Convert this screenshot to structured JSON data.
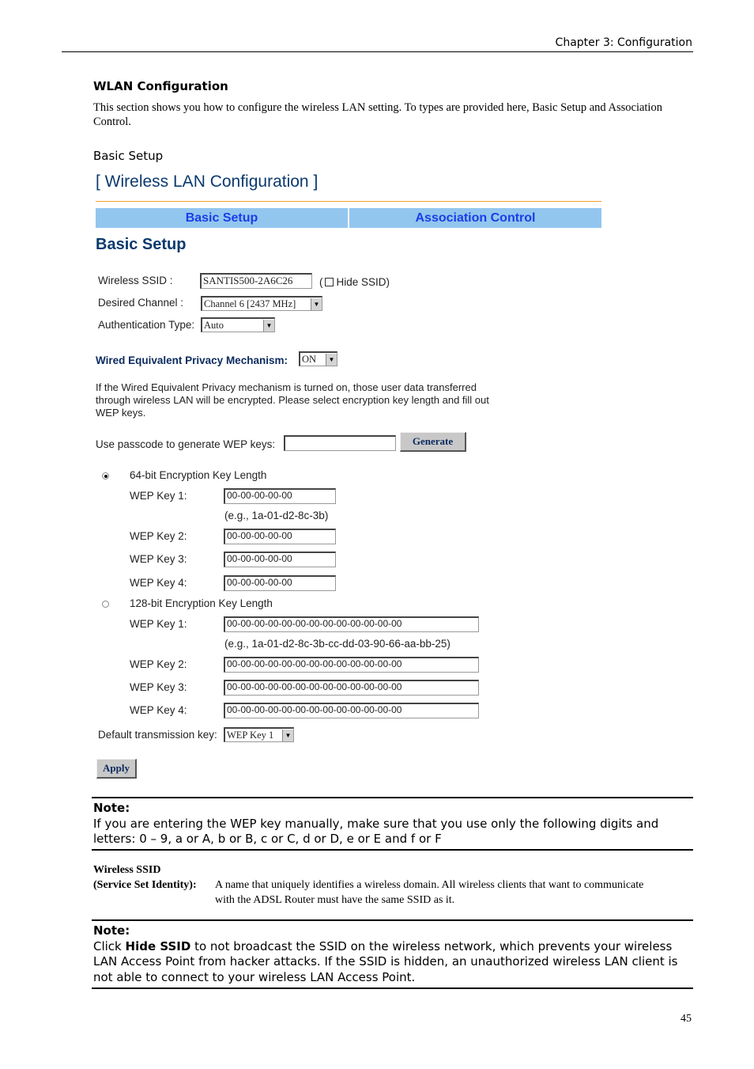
{
  "page_header": "Chapter 3: Configuration",
  "section_title": "WLAN Configuration",
  "intro": "This section shows you how to configure the wireless LAN setting. To types are provided here, Basic Setup and Association Control.",
  "subsection": "Basic Setup",
  "ui": {
    "title": "[ Wireless LAN Configuration ]",
    "tabs": [
      {
        "label": "Basic Setup"
      },
      {
        "label": "Association Control"
      }
    ],
    "heading": "Basic Setup",
    "fields": {
      "ssid_label": "Wireless SSID :",
      "ssid_value": "SANTIS500-2A6C26",
      "hide_ssid_open": "(",
      "hide_ssid_label": "Hide SSID)",
      "channel_label": "Desired Channel :",
      "channel_value": "Channel 6 [2437 MHz]",
      "auth_label": "Authentication Type:",
      "auth_value": "Auto"
    },
    "wep": {
      "label": "Wired Equivalent Privacy Mechanism:",
      "value": "ON",
      "description": "If the Wired Equivalent Privacy mechanism is turned on, those user data transferred through wireless LAN will be encrypted. Please select encryption key length and fill out WEP keys.",
      "passcode_label": "Use passcode to generate WEP keys:",
      "passcode_value": "",
      "generate_label": "Generate"
    },
    "key64": {
      "label": "64-bit Encryption Key Length",
      "selected": true,
      "keys": [
        {
          "label": "WEP Key 1:",
          "value": "00-00-00-00-00"
        },
        {
          "label": "WEP Key 2:",
          "value": "00-00-00-00-00"
        },
        {
          "label": "WEP Key 3:",
          "value": "00-00-00-00-00"
        },
        {
          "label": "WEP Key 4:",
          "value": "00-00-00-00-00"
        }
      ],
      "example": "(e.g., 1a-01-d2-8c-3b)"
    },
    "key128": {
      "label": "128-bit Encryption Key Length",
      "selected": false,
      "keys": [
        {
          "label": "WEP Key 1:",
          "value": "00-00-00-00-00-00-00-00-00-00-00-00-00"
        },
        {
          "label": "WEP Key 2:",
          "value": "00-00-00-00-00-00-00-00-00-00-00-00-00"
        },
        {
          "label": "WEP Key 3:",
          "value": "00-00-00-00-00-00-00-00-00-00-00-00-00"
        },
        {
          "label": "WEP Key 4:",
          "value": "00-00-00-00-00-00-00-00-00-00-00-00-00"
        }
      ],
      "example": "(e.g., 1a-01-d2-8c-3b-cc-dd-03-90-66-aa-bb-25)"
    },
    "default_key_label": "Default transmission key:",
    "default_key_value": "WEP Key 1",
    "apply_label": "Apply"
  },
  "note1": {
    "title": "Note:",
    "text": "If you are entering the WEP key manually, make sure that you use only the following digits and letters: 0 – 9, a or A, b or B, c or C, d or D, e or E and f or F"
  },
  "definition": {
    "term1": "Wireless SSID",
    "term2": "(Service Set Identity):",
    "text": "A name that uniquely identifies a wireless domain. All wireless clients that want to communicate with the ADSL Router must have the same SSID as it."
  },
  "note2": {
    "title": "Note:",
    "pre": "Click ",
    "bold": "Hide SSID",
    "post": " to not broadcast the SSID on the wireless network, which prevents your wireless LAN Access Point from hacker attacks. If the SSID is hidden, an unauthorized wireless LAN client is not able to connect to your wireless LAN Access Point."
  },
  "page_number": "45"
}
